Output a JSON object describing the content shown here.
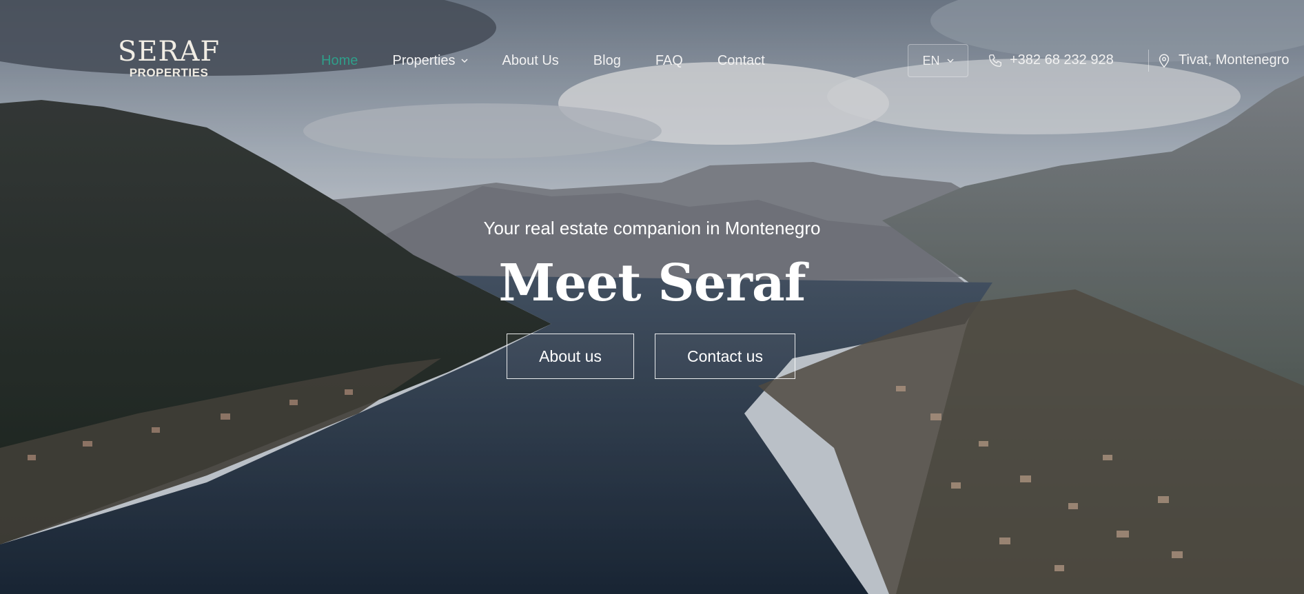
{
  "brand": {
    "name": "SERAF",
    "subtitle": "PROPERTIES"
  },
  "nav": {
    "items": [
      {
        "label": "Home",
        "active": true
      },
      {
        "label": "Properties",
        "has_dropdown": true
      },
      {
        "label": "About Us"
      },
      {
        "label": "Blog"
      },
      {
        "label": "FAQ"
      },
      {
        "label": "Contact"
      }
    ]
  },
  "language": {
    "selected": "EN"
  },
  "contact": {
    "phone": "+382 68 232 928",
    "location": "Tivat, Montenegro"
  },
  "hero": {
    "tagline": "Your real estate companion in Montenegro",
    "title": "Meet Seraf",
    "buttons": {
      "about": "About us",
      "contact": "Contact us"
    }
  },
  "colors": {
    "accent": "#2f9e8a",
    "text": "#f2f2f2"
  },
  "icons": {
    "phone": "phone-icon",
    "location": "location-pin-icon",
    "dropdown": "chevron-down-icon"
  }
}
